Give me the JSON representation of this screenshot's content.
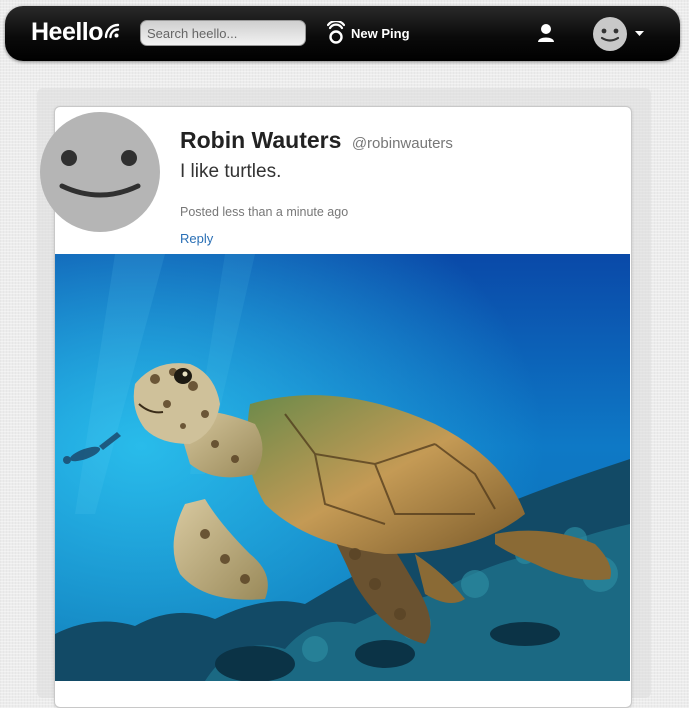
{
  "navbar": {
    "logo": "Heello",
    "search_placeholder": "Search heello...",
    "new_ping_label": "New Ping",
    "icons": [
      "heello-waves-icon",
      "ping-icon",
      "user-icon",
      "avatar-icon",
      "caret-down-icon"
    ]
  },
  "ping": {
    "author_name": "Robin Wauters",
    "author_handle": "@robinwauters",
    "text": "I like turtles.",
    "posted": "Posted less than a minute ago",
    "reply_label": "Reply",
    "photo_subject": "sea turtle swimming over coral reef with scuba divers"
  },
  "colors": {
    "navbar": "#111111",
    "link": "#2a6fb5",
    "avatar": "#b5b5b5",
    "ocean_deep": "#0a3d8f",
    "ocean_light": "#1aa7d9"
  }
}
